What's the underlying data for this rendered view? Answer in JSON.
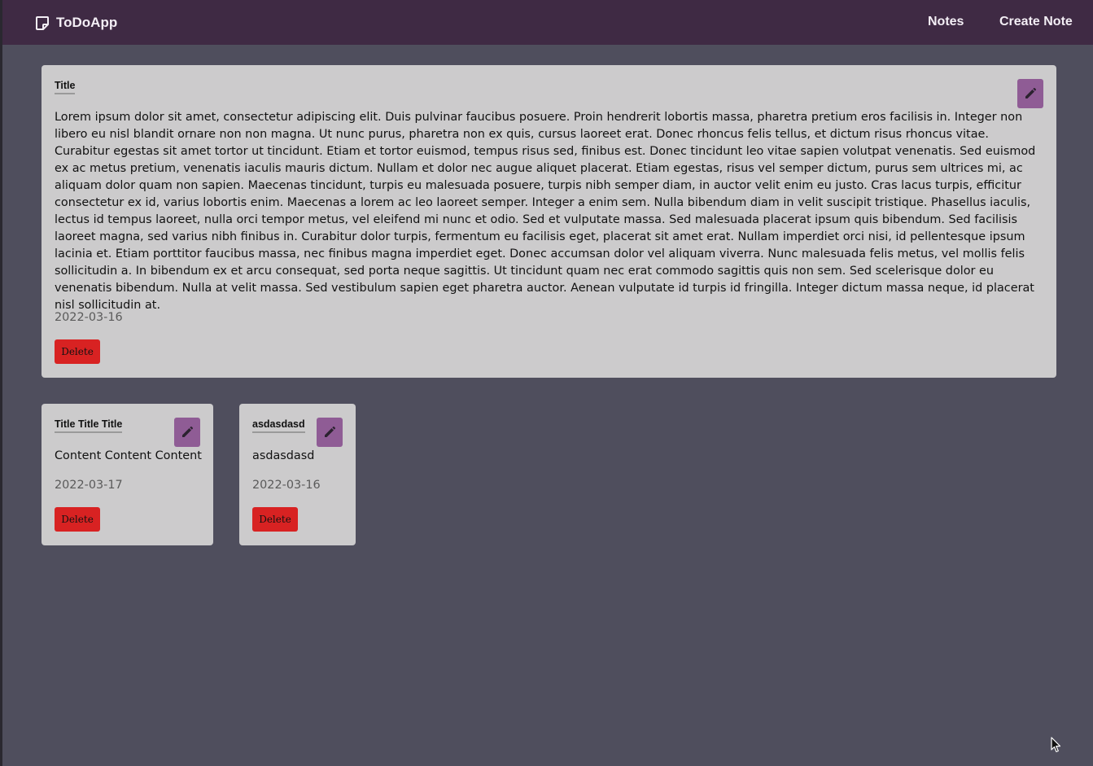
{
  "app": {
    "brand": "ToDoApp"
  },
  "nav": {
    "notes_label": "Notes",
    "create_label": "Create Note"
  },
  "notes": [
    {
      "title": "Title",
      "content": "Lorem ipsum dolor sit amet, consectetur adipiscing elit. Duis pulvinar faucibus posuere. Proin hendrerit lobortis massa, pharetra pretium eros facilisis in. Integer non libero eu nisl blandit ornare non non magna. Ut nunc purus, pharetra non ex quis, cursus laoreet erat. Donec rhoncus felis tellus, et dictum risus rhoncus vitae. Curabitur egestas sit amet tortor ut tincidunt. Etiam et tortor euismod, tempus risus sed, finibus est. Donec tincidunt leo vitae sapien volutpat venenatis. Sed euismod ex ac metus pretium, venenatis iaculis mauris dictum. Nullam et dolor nec augue aliquet placerat. Etiam egestas, risus vel semper dictum, purus sem ultrices mi, ac aliquam dolor quam non sapien. Maecenas tincidunt, turpis eu malesuada posuere, turpis nibh semper diam, in auctor velit enim eu justo. Cras lacus turpis, efficitur consectetur ex id, varius lobortis enim. Maecenas a lorem ac leo laoreet semper. Integer a enim sem. Nulla bibendum diam in velit suscipit tristique. Phasellus iaculis, lectus id tempus laoreet, nulla orci tempor metus, vel eleifend mi nunc et odio. Sed et vulputate massa. Sed malesuada placerat ipsum quis bibendum. Sed facilisis laoreet magna, sed varius nibh finibus in. Curabitur dolor turpis, fermentum eu facilisis eget, placerat sit amet erat. Nullam imperdiet orci nisi, id pellentesque ipsum lacinia et. Etiam porttitor faucibus massa, nec finibus magna imperdiet eget. Donec accumsan dolor vel aliquam viverra. Nunc malesuada felis metus, vel mollis felis sollicitudin a. In bibendum ex et arcu consequat, sed porta neque sagittis. Ut tincidunt quam nec erat commodo sagittis quis non sem. Sed scelerisque dolor eu venenatis bibendum. Nulla at velit massa. Sed vestibulum sapien eget pharetra auctor. Aenean vulputate id turpis id fringilla. Integer dictum massa neque, id placerat nisl sollicitudin at.",
      "date": "2022-03-16",
      "delete_label": "Delete"
    },
    {
      "title": "Title Title Title",
      "content": "Content Content Content",
      "date": "2022-03-17",
      "delete_label": "Delete"
    },
    {
      "title": "asdasdasd",
      "content": "asdasdasd",
      "date": "2022-03-16",
      "delete_label": "Delete"
    }
  ],
  "icons": {
    "brand": "note-icon",
    "edit": "pencil-icon",
    "cursor": "mouse-pointer-icon"
  },
  "colors": {
    "page_background": "#4f4e5d",
    "navbar": "#3f2a44",
    "card": "#cccbcc",
    "edit_button": "#8f5c95",
    "delete_button": "#d82222"
  }
}
